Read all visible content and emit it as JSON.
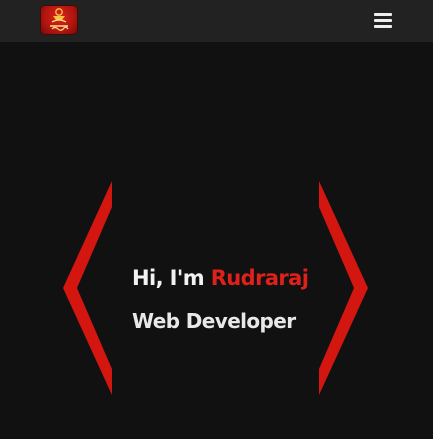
{
  "navbar": {
    "logo_icon": "rudraraj-logo-emblem",
    "menu_icon": "hamburger-menu-icon"
  },
  "hero": {
    "greeting": "Hi, I'm",
    "name": "Rudraraj",
    "role": "Web Developer"
  },
  "colors": {
    "background": "#111111",
    "navbar": "#222222",
    "accent": "#e0201a",
    "text": "#f2f2f2"
  }
}
